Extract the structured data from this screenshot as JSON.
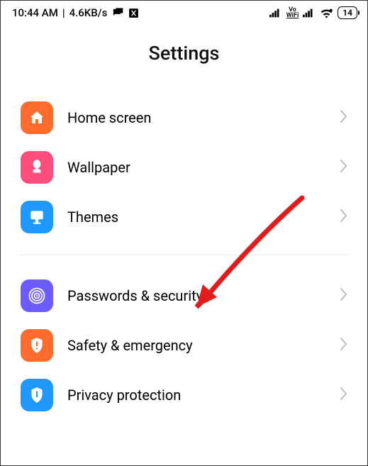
{
  "statusbar": {
    "time": "10:44 AM",
    "speed": "4.6KB/s",
    "battery": "14",
    "vo": "Vo",
    "wifi": "WiFi"
  },
  "header": {
    "title": "Settings"
  },
  "colors": {
    "orange": "#ff6b2d",
    "pink": "#ff4d7e",
    "blue": "#1f98ff",
    "purple": "#6d5cff",
    "orange2": "#ff6b2d",
    "blue2": "#1f98ff",
    "arrow": "#e21c1c"
  },
  "settings": {
    "group1": [
      {
        "label": "Home screen",
        "icon": "home-icon",
        "color": "orange"
      },
      {
        "label": "Wallpaper",
        "icon": "wallpaper-icon",
        "color": "pink"
      },
      {
        "label": "Themes",
        "icon": "themes-icon",
        "color": "blue"
      }
    ],
    "group2": [
      {
        "label": "Passwords & security",
        "icon": "security-icon",
        "color": "purple"
      },
      {
        "label": "Safety & emergency",
        "icon": "safety-icon",
        "color": "orange2"
      },
      {
        "label": "Privacy protection",
        "icon": "privacy-icon",
        "color": "blue2"
      }
    ]
  }
}
